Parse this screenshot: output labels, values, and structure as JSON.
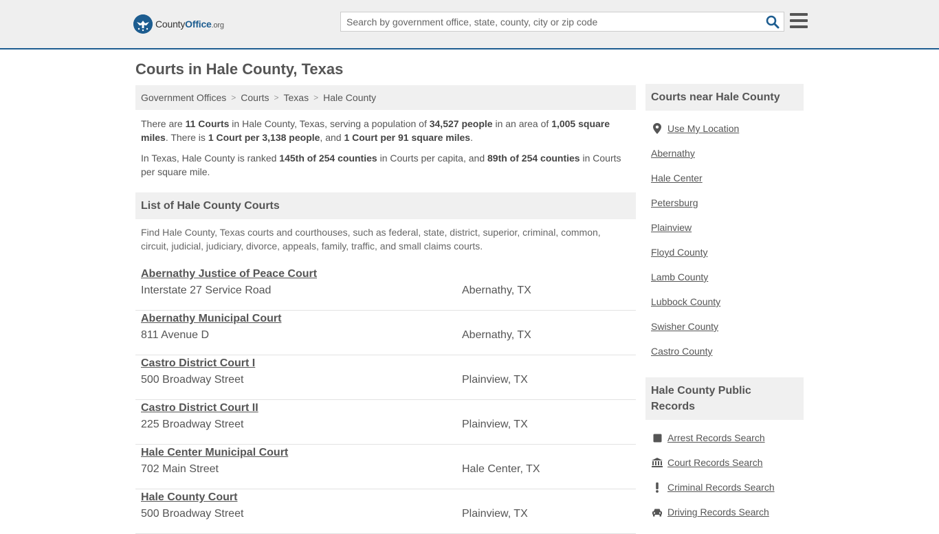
{
  "header": {
    "logo_text_county": "County",
    "logo_text_office": "Office",
    "logo_text_org": ".org",
    "search_placeholder": "Search by government office, state, county, city or zip code"
  },
  "page_title": "Courts in Hale County, Texas",
  "breadcrumb": [
    "Government Offices",
    "Courts",
    "Texas",
    "Hale County"
  ],
  "intro": {
    "p1": [
      {
        "t": "There are "
      },
      {
        "b": "11 Courts"
      },
      {
        "t": " in Hale County, Texas, serving a population of "
      },
      {
        "b": "34,527 people"
      },
      {
        "t": " in an area of "
      },
      {
        "b": "1,005 square miles"
      },
      {
        "t": ". There is "
      },
      {
        "b": "1 Court per 3,138 people"
      },
      {
        "t": ", and "
      },
      {
        "b": "1 Court per 91 square miles"
      },
      {
        "t": "."
      }
    ],
    "p2": [
      {
        "t": "In Texas, Hale County is ranked "
      },
      {
        "b": "145th of 254 counties"
      },
      {
        "t": " in Courts per capita, and "
      },
      {
        "b": "89th of 254 counties"
      },
      {
        "t": " in Courts per square mile."
      }
    ]
  },
  "list_section": {
    "title": "List of Hale County Courts",
    "description": "Find Hale County, Texas courts and courthouses, such as federal, state, district, superior, criminal, common, circuit, judicial, judiciary, divorce, appeals, family, traffic, and small claims courts."
  },
  "courts": [
    {
      "name": "Abernathy Justice of Peace Court",
      "address": "Interstate 27 Service Road",
      "city": "Abernathy, TX"
    },
    {
      "name": "Abernathy Municipal Court",
      "address": "811 Avenue D",
      "city": "Abernathy, TX"
    },
    {
      "name": "Castro District Court I",
      "address": "500 Broadway Street",
      "city": "Plainview, TX"
    },
    {
      "name": "Castro District Court II",
      "address": "225 Broadway Street",
      "city": "Plainview, TX"
    },
    {
      "name": "Hale Center Municipal Court",
      "address": "702 Main Street",
      "city": "Hale Center, TX"
    },
    {
      "name": "Hale County Court",
      "address": "500 Broadway Street",
      "city": "Plainview, TX"
    }
  ],
  "sidebar": {
    "nearby_title": "Courts near Hale County",
    "use_location": "Use My Location",
    "nearby": [
      "Abernathy",
      "Hale Center",
      "Petersburg",
      "Plainview",
      "Floyd County",
      "Lamb County",
      "Lubbock County",
      "Swisher County",
      "Castro County"
    ],
    "records_title": "Hale County Public Records",
    "records": [
      {
        "label": "Arrest Records Search",
        "icon": "square-icon"
      },
      {
        "label": "Court Records Search",
        "icon": "courthouse-icon"
      },
      {
        "label": "Criminal Records Search",
        "icon": "exclamation-icon"
      },
      {
        "label": "Driving Records Search",
        "icon": "car-icon"
      }
    ]
  }
}
